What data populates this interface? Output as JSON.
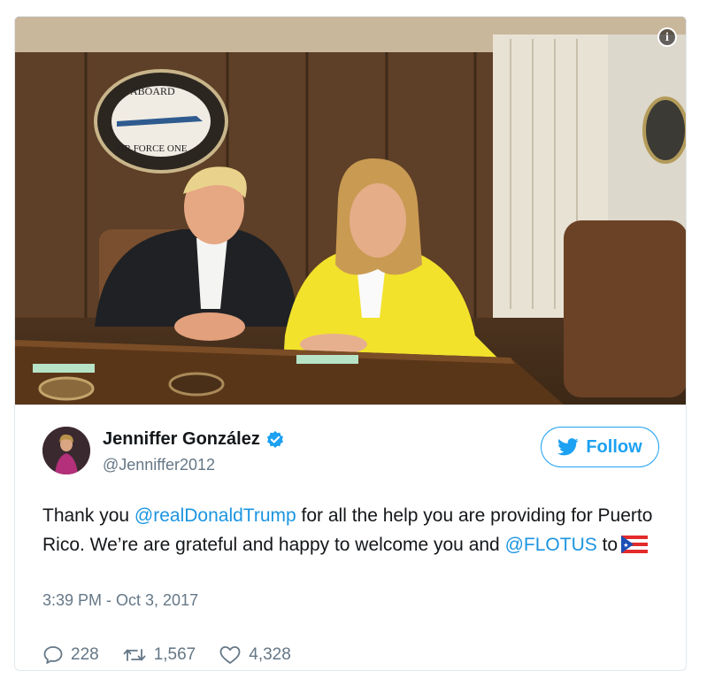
{
  "photo": {
    "seal_top_text": "ABOARD",
    "seal_bottom_text": "AIR FORCE ONE",
    "info_icon": "info-icon"
  },
  "author": {
    "display_name": "Jenniffer González",
    "handle": "@Jenniffer2012",
    "verified": true
  },
  "follow_button": {
    "label": "Follow",
    "icon": "twitter-bird-icon",
    "color": "#1da1f2"
  },
  "tweet": {
    "text_1": "Thank you ",
    "mention_1": "@realDonaldTrump",
    "text_2": " for all the help you are providing for Puerto Rico. We’re are grateful and happy to welcome you and ",
    "mention_2": "@FLOTUS",
    "text_3": " to",
    "flag_icon": "puerto-rico-flag-icon",
    "mention_color": "#1b95e0"
  },
  "timestamp": "3:39 PM - Oct 3, 2017",
  "actions": {
    "replies": "228",
    "retweets": "1,567",
    "likes": "4,328"
  }
}
